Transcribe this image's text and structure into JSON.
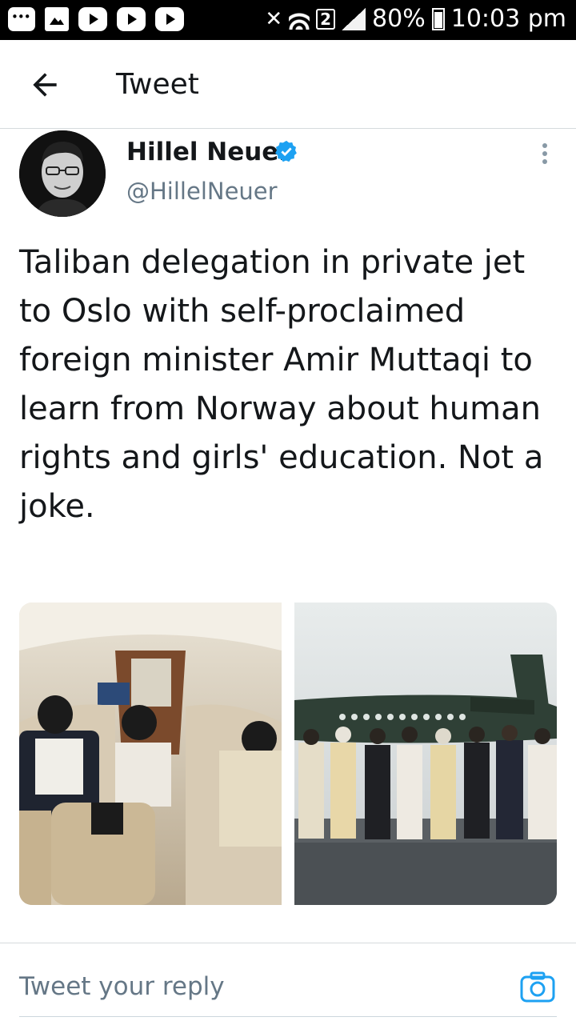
{
  "status_bar": {
    "battery": "80%",
    "time": "10:03 pm",
    "sim_slot": "2"
  },
  "header": {
    "title": "Tweet"
  },
  "tweet": {
    "author_name": "Hillel Neuer",
    "author_handle": "@HillelNeuer",
    "text": "Taliban delegation in private jet to Oslo with self-proclaimed foreign minister Amir Muttaqi to learn from Norway about human rights and girls' education. Not a joke.",
    "verified": true,
    "photos": [
      "jet-cabin-photo",
      "tarmac-group-photo"
    ]
  },
  "reply": {
    "placeholder": "Tweet your reply"
  },
  "colors": {
    "accent": "#1DA1F2",
    "text_primary": "#14171A",
    "text_secondary": "#657786"
  }
}
